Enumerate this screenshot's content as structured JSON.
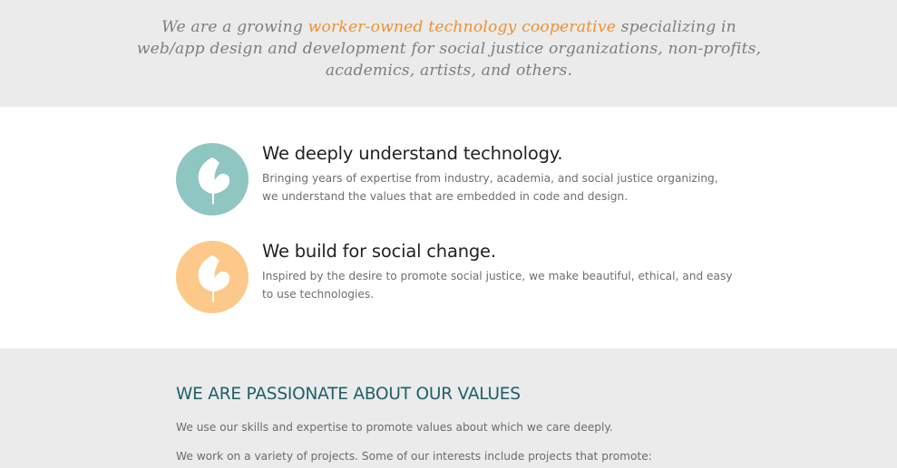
{
  "intro": {
    "before": "We are a growing ",
    "highlight": "worker-owned technology cooperative",
    "after": " specializing in web/app design and development for social justice organizations, non-profits, academics, artists, and others.",
    "accent_color": "#f0902d"
  },
  "features": [
    {
      "icon": "leaf-icon",
      "circle_color": "#8fc6c1",
      "title": "We deeply understand technology.",
      "description": "Bringing years of expertise from industry, academia, and social justice organizing, we understand the values that are embedded in code and design."
    },
    {
      "icon": "leaf-icon",
      "circle_color": "#fdc98a",
      "title": "We build for social change.",
      "description": "Inspired by the desire to promote social justice, we make beautiful, ethical, and easy to use technologies."
    }
  ],
  "values": {
    "heading": "WE ARE PASSIONATE ABOUT OUR VALUES",
    "heading_color": "#1e5f6a",
    "paragraph1": "We use our skills and expertise to promote values about which we care deeply.",
    "paragraph2": "We work on a variety of projects. Some of our interests include projects that promote:"
  }
}
